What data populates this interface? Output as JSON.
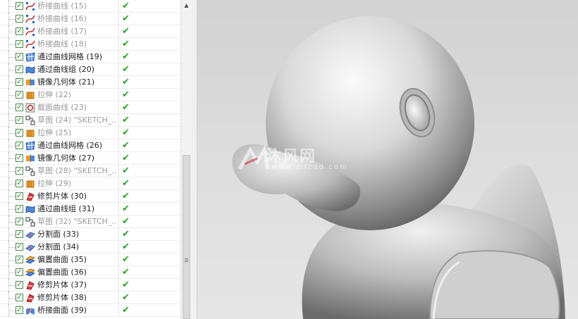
{
  "tree": {
    "items": [
      {
        "label": "桥接曲线 (15)",
        "icon": "bridge-curve-icon",
        "active": false
      },
      {
        "label": "桥接曲线 (16)",
        "icon": "bridge-curve-icon",
        "active": false
      },
      {
        "label": "桥接曲线 (17)",
        "icon": "bridge-curve-icon",
        "active": false
      },
      {
        "label": "桥接曲线 (18)",
        "icon": "bridge-curve-icon",
        "active": false
      },
      {
        "label": "通过曲线网格 (19)",
        "icon": "curve-mesh-icon",
        "active": true
      },
      {
        "label": "通过曲线组 (20)",
        "icon": "curve-group-icon",
        "active": true
      },
      {
        "label": "镜像几何体 (21)",
        "icon": "mirror-body-icon",
        "active": true
      },
      {
        "label": "拉伸 (22)",
        "icon": "extrude-icon",
        "active": false
      },
      {
        "label": "截面曲线 (23)",
        "icon": "section-curve-icon",
        "active": false
      },
      {
        "label": "草图 (24) \"SKETCH_...",
        "icon": "sketch-icon",
        "active": false
      },
      {
        "label": "拉伸 (25)",
        "icon": "extrude-icon",
        "active": false
      },
      {
        "label": "通过曲线网格 (26)",
        "icon": "curve-mesh-icon",
        "active": true
      },
      {
        "label": "镜像几何体 (27)",
        "icon": "mirror-body-icon",
        "active": true
      },
      {
        "label": "草图 (28) \"SKETCH_...",
        "icon": "sketch-icon",
        "active": false
      },
      {
        "label": "拉伸 (29)",
        "icon": "extrude-icon",
        "active": false
      },
      {
        "label": "修剪片体 (30)",
        "icon": "trim-sheet-icon",
        "active": true
      },
      {
        "label": "通过曲线组 (31)",
        "icon": "curve-group-icon",
        "active": true
      },
      {
        "label": "草图 (32) \"SKETCH_...",
        "icon": "sketch-icon",
        "active": false
      },
      {
        "label": "分割面 (33)",
        "icon": "divide-face-icon",
        "active": true
      },
      {
        "label": "分割面 (34)",
        "icon": "divide-face-icon",
        "active": true
      },
      {
        "label": "偏置曲面 (35)",
        "icon": "offset-surface-icon",
        "active": true
      },
      {
        "label": "偏置曲面 (36)",
        "icon": "offset-surface-icon",
        "active": true
      },
      {
        "label": "修剪片体 (37)",
        "icon": "trim-sheet-icon",
        "active": true
      },
      {
        "label": "修剪片体 (38)",
        "icon": "trim-sheet-icon",
        "active": true
      },
      {
        "label": "桥接曲面 (39)",
        "icon": "bridge-surface-icon",
        "active": true
      }
    ]
  },
  "viewport": {
    "watermark": "沐风网",
    "watermark_url": "www.mfcad.com"
  },
  "colors": {
    "check": "#2f9e2f",
    "active_text": "#1e1e1e",
    "inactive_text": "#9a9a9a",
    "viewport_bg": "#d8d8d8"
  }
}
